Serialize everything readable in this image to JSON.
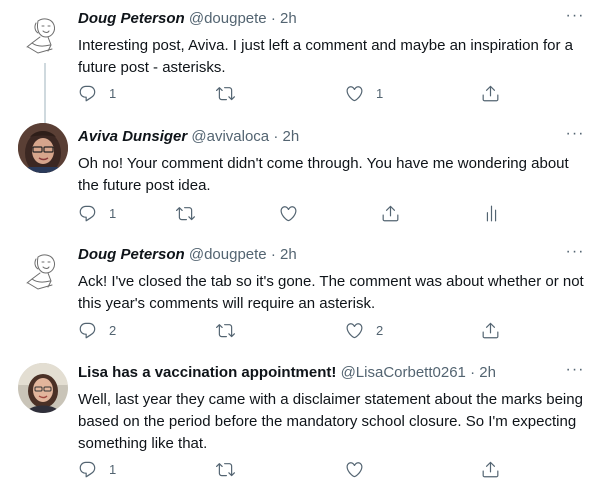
{
  "tweets": [
    {
      "name": "Doug Peterson",
      "handle": "@dougpete",
      "sep": "·",
      "time": "2h",
      "more": "···",
      "text": "Interesting post, Aviva.  I just left a comment and maybe an inspiration for a future post - asterisks.",
      "reply_count": "1",
      "retweet_count": "",
      "like_count": "1",
      "avatar_icon": "doug-sketch-avatar"
    },
    {
      "name": "Aviva Dunsiger",
      "handle": "@avivaloca",
      "sep": "·",
      "time": "2h",
      "more": "···",
      "text": "Oh no! Your comment didn't come through. You have me wondering about the future post idea.",
      "reply_count": "1",
      "retweet_count": "",
      "like_count": "",
      "avatar_icon": "aviva-photo-avatar",
      "has_analytics": true
    },
    {
      "name": "Doug Peterson",
      "handle": "@dougpete",
      "sep": "·",
      "time": "2h",
      "more": "···",
      "text": "Ack!  I've closed the tab so it's gone.  The comment was about whether or not this year's comments will require an asterisk.",
      "reply_count": "2",
      "retweet_count": "",
      "like_count": "2",
      "avatar_icon": "doug-sketch-avatar"
    },
    {
      "name": "Lisa has a vaccination appointment!",
      "handle": "@LisaCorbett0261",
      "sep": "·",
      "time": "2h",
      "more": "···",
      "text": "Well, last year they came with a disclaimer statement about the marks being based on the period before the mandatory school closure. So I'm expecting something like that.",
      "reply_count": "1",
      "retweet_count": "",
      "like_count": "",
      "avatar_icon": "lisa-photo-avatar"
    }
  ],
  "icons": {
    "reply": "reply-icon",
    "retweet": "retweet-icon",
    "like": "heart-icon",
    "share": "share-icon",
    "analytics": "analytics-icon"
  },
  "colors": {
    "text": "#0f1419",
    "secondary": "#536471",
    "thread_line": "#cfd9de"
  }
}
